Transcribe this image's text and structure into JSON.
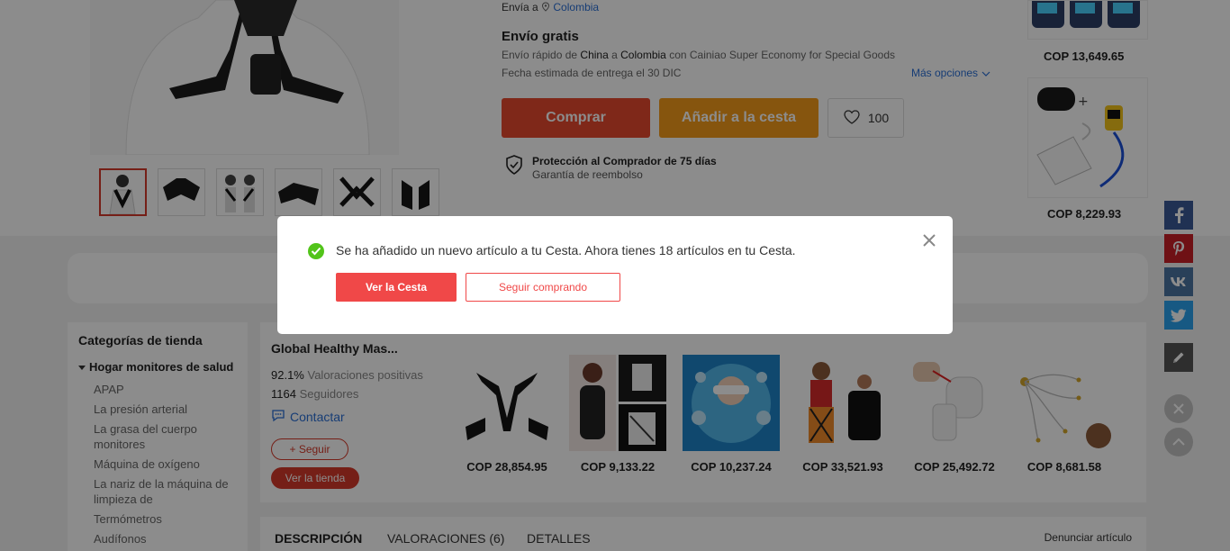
{
  "product": {
    "ship_to_label": "Envía a",
    "ship_to_country": "Colombia",
    "free_shipping": "Envío gratis",
    "ship_desc_prefix": "Envío rápido de",
    "ship_from": "China",
    "ship_conn": "a",
    "ship_dest": "Colombia",
    "ship_desc_suffix": "con Cainiao Super Economy for Special Goods",
    "delivery_date": "Fecha estimada de entrega el 30 DIC",
    "more_options": "Más opciones",
    "buy_label": "Comprar",
    "add_cart_label": "Añadir a la cesta",
    "wishlist_count": "100",
    "protection_title": "Protección al Comprador de 75 días",
    "protection_sub": "Garantía de reembolso"
  },
  "side_products": [
    {
      "price": "COP 13,649.65"
    },
    {
      "price": "COP 8,229.93"
    }
  ],
  "categories": {
    "title": "Categorías de tienda",
    "group": "Hogar monitores de salud",
    "items": [
      "APAP",
      "La presión arterial",
      "La grasa del cuerpo monitores",
      "Máquina de oxígeno",
      "La nariz de la máquina de limpieza de",
      "Termómetros",
      "Audífonos"
    ]
  },
  "store": {
    "name": "Global Healthy Mas...",
    "positive_pct": "92.1%",
    "positive_label": "Valoraciones positivas",
    "followers_count": "1164",
    "followers_label": "Seguidores",
    "contact_label": "Contactar",
    "follow_label": "+ Seguir",
    "visit_label": "Ver la tienda",
    "products": [
      {
        "price": "COP 28,854.95"
      },
      {
        "price": "COP 9,133.22"
      },
      {
        "price": "COP 10,237.24"
      },
      {
        "price": "COP 33,521.93"
      },
      {
        "price": "COP 25,492.72"
      },
      {
        "price": "COP 8,681.58"
      }
    ]
  },
  "tabs": [
    {
      "label": "DESCRIPCIÓN"
    },
    {
      "label": "VALORACIONES (6)"
    },
    {
      "label": "DETALLES"
    }
  ],
  "report_label": "Denunciar artículo",
  "share_icons": [
    "facebook-icon",
    "pinterest-icon",
    "vk-icon",
    "twitter-icon",
    "pencil-icon"
  ],
  "dialog": {
    "message": "Se ha añadido un nuevo artículo a tu Cesta. Ahora tienes 18 artículos en tu Cesta.",
    "view_cart_label": "Ver la Cesta",
    "continue_label": "Seguir comprando"
  },
  "colors": {
    "buy": "#e8492e",
    "add_cart": "#f59b1b",
    "brand_red": "#d63a2a",
    "dialog_red": "#f04848",
    "success": "#52c41a",
    "link": "#2a6fd6"
  }
}
